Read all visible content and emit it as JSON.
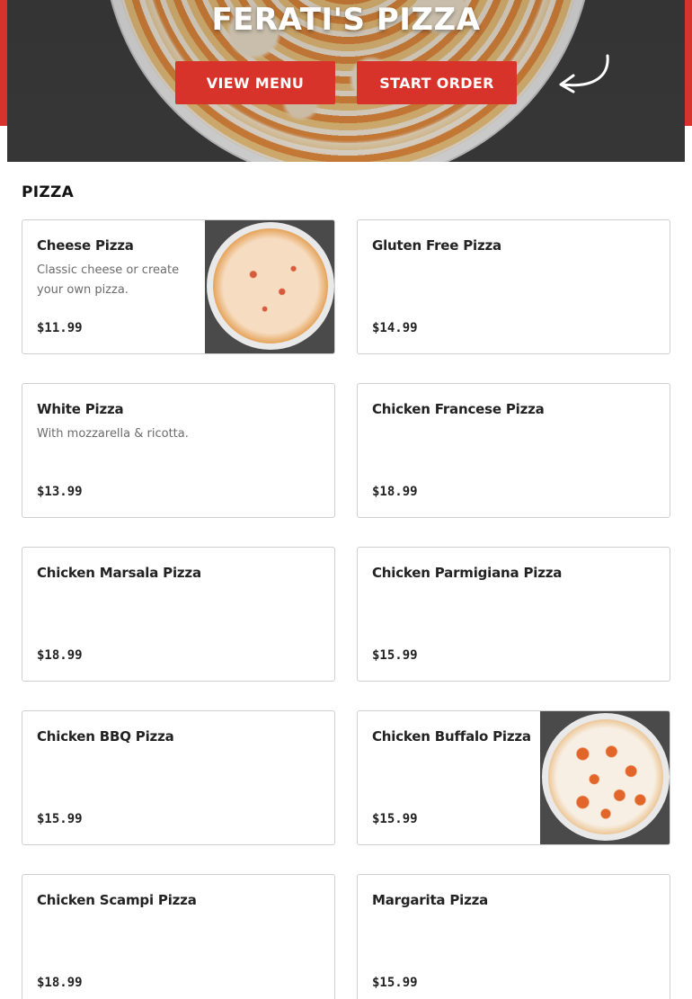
{
  "hero": {
    "title": "FERATI'S PIZZA",
    "view_menu_label": "VIEW MENU",
    "start_order_label": "START ORDER",
    "accent_color": "#d7332a"
  },
  "section": {
    "title": "PIZZA"
  },
  "items": [
    {
      "name": "Cheese Pizza",
      "desc": "Classic cheese or create your own pizza.",
      "price": "$11.99",
      "image": "cheese-pizza-photo"
    },
    {
      "name": "Gluten Free Pizza",
      "desc": "",
      "price": "$14.99"
    },
    {
      "name": "White Pizza",
      "desc": "With mozzarella & ricotta.",
      "price": "$13.99"
    },
    {
      "name": "Chicken Francese Pizza",
      "desc": "",
      "price": "$18.99"
    },
    {
      "name": "Chicken Marsala Pizza",
      "desc": "",
      "price": "$18.99"
    },
    {
      "name": "Chicken Parmigiana Pizza",
      "desc": "",
      "price": "$15.99"
    },
    {
      "name": "Chicken BBQ Pizza",
      "desc": "",
      "price": "$15.99"
    },
    {
      "name": "Chicken Buffalo Pizza",
      "desc": "",
      "price": "$15.99",
      "image": "buffalo-pizza-photo"
    },
    {
      "name": "Chicken Scampi Pizza",
      "desc": "",
      "price": "$18.99"
    },
    {
      "name": "Margarita Pizza",
      "desc": "",
      "price": "$15.99"
    }
  ]
}
